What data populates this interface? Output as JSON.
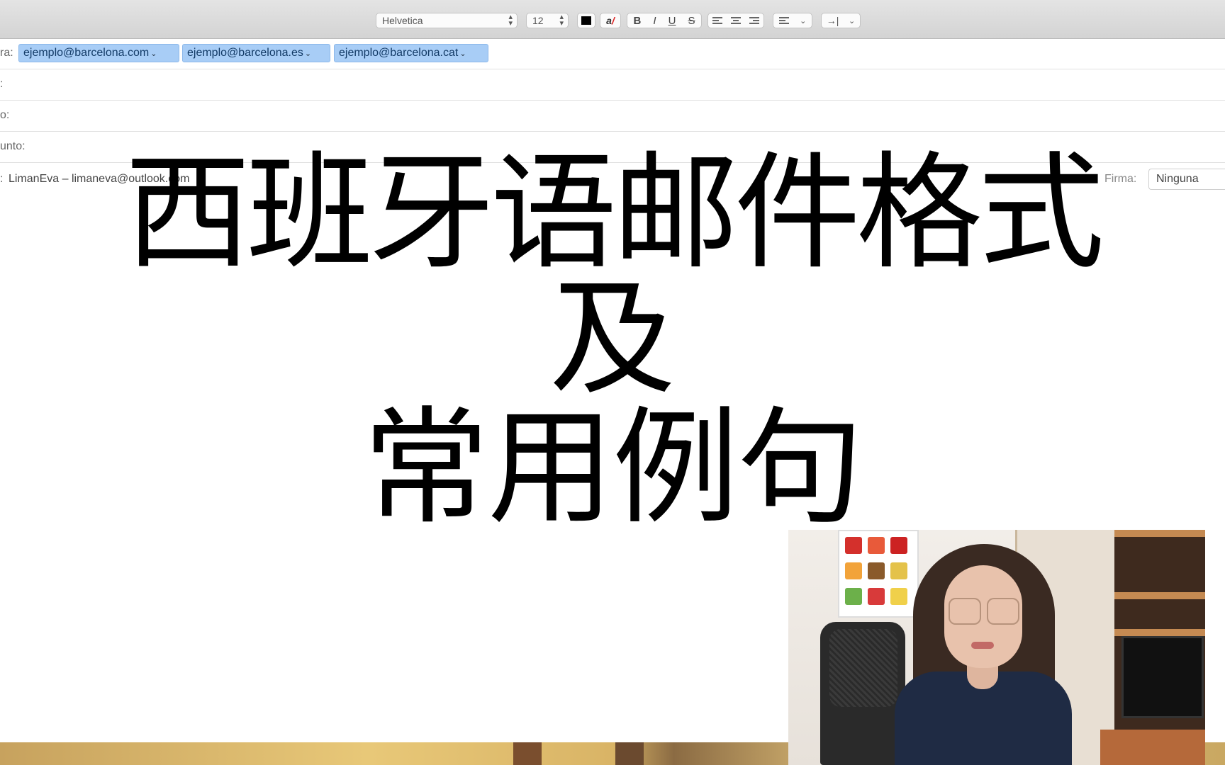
{
  "toolbar": {
    "font": "Helvetica",
    "size": "12",
    "text_color": "#000000",
    "style_buttons": [
      "B",
      "I",
      "U",
      "S"
    ],
    "indent_glyph": "→|"
  },
  "header": {
    "to_label": "ra:",
    "recipients": [
      "ejemplo@barcelona.com",
      "ejemplo@barcelona.es",
      "ejemplo@barcelona.cat"
    ],
    "cc_label": ":",
    "bcc_label": "o:",
    "subject_label": "unto:",
    "from_label": ":",
    "from_value": "LimanEva – limaneva@outlook.com",
    "firma_label": "Firma:",
    "firma_value": "Ninguna"
  },
  "title": {
    "line1": "西班牙语邮件格式",
    "line2": "及",
    "line3": "常用例句"
  },
  "colors": {
    "chip_bg": "#a8cdf6",
    "toolbar_bg": "#d9d9d9",
    "title_text": "#000000"
  }
}
